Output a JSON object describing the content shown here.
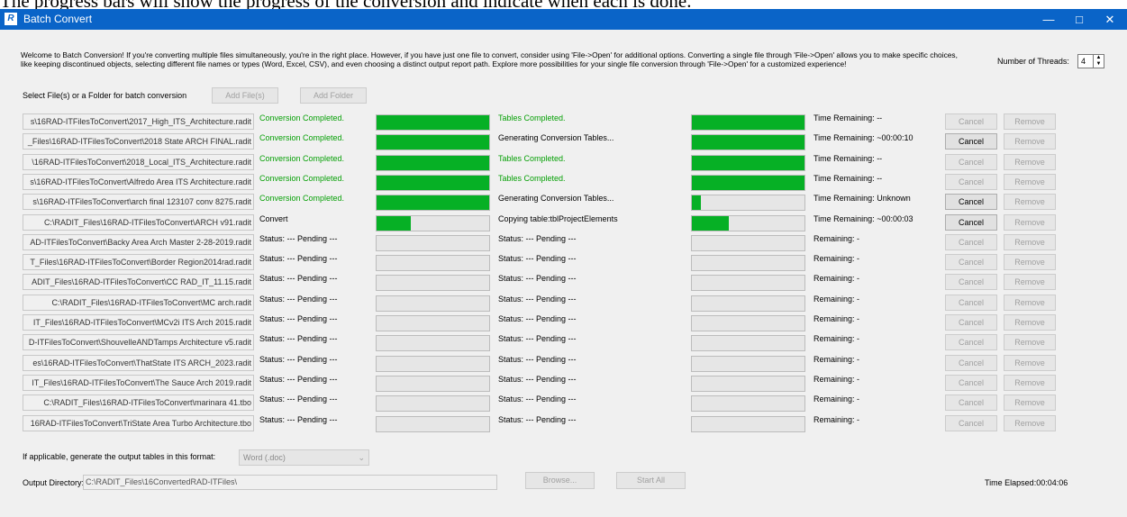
{
  "caption": "The progress bars will show the progress of the conversion and indicate when each is done.",
  "window": {
    "title": "Batch Convert",
    "icon_letter": "R"
  },
  "intro_text": "Welcome to Batch Conversion! If you're converting multiple files simultaneously, you're in the right place. However, if you have just one file to convert, consider using 'File->Open' for additional options. Converting a single file through 'File->Open' allows you to make specific choices, like keeping discontinued objects, selecting different file names or types (Word, Excel, CSV), and even choosing a distinct output report path. Explore more possibilities for your single file conversion through 'File->Open' for a customized experience!",
  "threads": {
    "label": "Number of Threads:",
    "value": "4"
  },
  "select_label": "Select File(s) or a Folder for batch conversion",
  "add_files_label": "Add File(s)",
  "add_folder_label": "Add Folder",
  "rows": [
    {
      "path": "s\\16RAD-ITFilesToConvert\\2017_High_ITS_Architecture.radit",
      "status1": "Conversion Completed.",
      "status1_done": true,
      "p1": 1.0,
      "status2": "Tables Completed.",
      "status2_done": true,
      "p2": 1.0,
      "time": "Time Remaining: --",
      "cancel_label": "Cancel",
      "cancel_enabled": false,
      "remove_label": "Remove"
    },
    {
      "path": "_Files\\16RAD-ITFilesToConvert\\2018 State ARCH FINAL.radit",
      "status1": "Conversion Completed.",
      "status1_done": true,
      "p1": 1.0,
      "status2": "Generating Conversion Tables...",
      "status2_done": false,
      "p2": 1.0,
      "time": "Time Remaining: ~00:00:10",
      "cancel_label": "Cancel",
      "cancel_enabled": true,
      "remove_label": "Remove"
    },
    {
      "path": "\\16RAD-ITFilesToConvert\\2018_Local_ITS_Architecture.radit",
      "status1": "Conversion Completed.",
      "status1_done": true,
      "p1": 1.0,
      "status2": "Tables Completed.",
      "status2_done": true,
      "p2": 1.0,
      "time": "Time Remaining: --",
      "cancel_label": "Cancel",
      "cancel_enabled": false,
      "remove_label": "Remove"
    },
    {
      "path": "s\\16RAD-ITFilesToConvert\\Alfredo Area ITS Architecture.radit",
      "status1": "Conversion Completed.",
      "status1_done": true,
      "p1": 1.0,
      "status2": "Tables Completed.",
      "status2_done": true,
      "p2": 1.0,
      "time": "Time Remaining: --",
      "cancel_label": "Cancel",
      "cancel_enabled": false,
      "remove_label": "Remove"
    },
    {
      "path": "s\\16RAD-ITFilesToConvert\\arch final 123107 conv 8275.radit",
      "status1": "Conversion Completed.",
      "status1_done": true,
      "p1": 1.0,
      "status2": "Generating Conversion Tables...",
      "status2_done": false,
      "p2": 0.08,
      "time": "Time Remaining: Unknown",
      "cancel_label": "Cancel",
      "cancel_enabled": true,
      "remove_label": "Remove"
    },
    {
      "path": "C:\\RADIT_Files\\16RAD-ITFilesToConvert\\ARCH v91.radit",
      "status1": "Convert",
      "status1_done": false,
      "p1": 0.3,
      "status2": "Copying table:tblProjectElements",
      "status2_done": false,
      "p2": 0.33,
      "time": "Time Remaining: ~00:00:03",
      "cancel_label": "Cancel",
      "cancel_enabled": true,
      "remove_label": "Remove"
    },
    {
      "path": "AD-ITFilesToConvert\\Backy Area Arch Master 2-28-2019.radit",
      "status1": "Status: --- Pending ---",
      "status1_done": false,
      "p1": 0,
      "status2": "Status: --- Pending ---",
      "status2_done": false,
      "p2": 0,
      "time": "Remaining: -",
      "cancel_label": "Cancel",
      "cancel_enabled": false,
      "remove_label": "Remove"
    },
    {
      "path": "T_Files\\16RAD-ITFilesToConvert\\Border Region2014rad.radit",
      "status1": "Status: --- Pending ---",
      "status1_done": false,
      "p1": 0,
      "status2": "Status: --- Pending ---",
      "status2_done": false,
      "p2": 0,
      "time": "Remaining: -",
      "cancel_label": "Cancel",
      "cancel_enabled": false,
      "remove_label": "Remove"
    },
    {
      "path": "ADIT_Files\\16RAD-ITFilesToConvert\\CC RAD_IT_11.15.radit",
      "status1": "Status: --- Pending ---",
      "status1_done": false,
      "p1": 0,
      "status2": "Status: --- Pending ---",
      "status2_done": false,
      "p2": 0,
      "time": "Remaining: -",
      "cancel_label": "Cancel",
      "cancel_enabled": false,
      "remove_label": "Remove"
    },
    {
      "path": "C:\\RADIT_Files\\16RAD-ITFilesToConvert\\MC arch.radit",
      "status1": "Status: --- Pending ---",
      "status1_done": false,
      "p1": 0,
      "status2": "Status: --- Pending ---",
      "status2_done": false,
      "p2": 0,
      "time": "Remaining: -",
      "cancel_label": "Cancel",
      "cancel_enabled": false,
      "remove_label": "Remove"
    },
    {
      "path": "IT_Files\\16RAD-ITFilesToConvert\\MCv2i ITS Arch 2015.radit",
      "status1": "Status: --- Pending ---",
      "status1_done": false,
      "p1": 0,
      "status2": "Status: --- Pending ---",
      "status2_done": false,
      "p2": 0,
      "time": "Remaining: -",
      "cancel_label": "Cancel",
      "cancel_enabled": false,
      "remove_label": "Remove"
    },
    {
      "path": "D-ITFilesToConvert\\ShouvelleANDTamps Architecture v5.radit",
      "status1": "Status: --- Pending ---",
      "status1_done": false,
      "p1": 0,
      "status2": "Status: --- Pending ---",
      "status2_done": false,
      "p2": 0,
      "time": "Remaining: -",
      "cancel_label": "Cancel",
      "cancel_enabled": false,
      "remove_label": "Remove"
    },
    {
      "path": "es\\16RAD-ITFilesToConvert\\ThatState ITS ARCH_2023.radit",
      "status1": "Status: --- Pending ---",
      "status1_done": false,
      "p1": 0,
      "status2": "Status: --- Pending ---",
      "status2_done": false,
      "p2": 0,
      "time": "Remaining: -",
      "cancel_label": "Cancel",
      "cancel_enabled": false,
      "remove_label": "Remove"
    },
    {
      "path": "IT_Files\\16RAD-ITFilesToConvert\\The Sauce Arch 2019.radit",
      "status1": "Status: --- Pending ---",
      "status1_done": false,
      "p1": 0,
      "status2": "Status: --- Pending ---",
      "status2_done": false,
      "p2": 0,
      "time": "Remaining: -",
      "cancel_label": "Cancel",
      "cancel_enabled": false,
      "remove_label": "Remove"
    },
    {
      "path": "C:\\RADIT_Files\\16RAD-ITFilesToConvert\\marinara 41.tbo",
      "status1": "Status: --- Pending ---",
      "status1_done": false,
      "p1": 0,
      "status2": "Status: --- Pending ---",
      "status2_done": false,
      "p2": 0,
      "time": "Remaining: -",
      "cancel_label": "Cancel",
      "cancel_enabled": false,
      "remove_label": "Remove"
    },
    {
      "path": "16RAD-ITFilesToConvert\\TriState Area Turbo Architecture.tbo",
      "status1": "Status: --- Pending ---",
      "status1_done": false,
      "p1": 0,
      "status2": "Status: --- Pending ---",
      "status2_done": false,
      "p2": 0,
      "time": "Remaining: -",
      "cancel_label": "Cancel",
      "cancel_enabled": false,
      "remove_label": "Remove"
    }
  ],
  "format": {
    "label": "If applicable, generate the output tables in this format:",
    "value": "Word (.doc)"
  },
  "output": {
    "label": "Output Directory:",
    "value": "C:\\RADIT_Files\\16ConvertedRAD-ITFiles\\"
  },
  "browse_label": "Browse...",
  "start_all_label": "Start All",
  "time_elapsed": "Time Elapsed:00:04:06",
  "colors": {
    "titlebar": "#0a64c8",
    "progress": "#06b025",
    "completed_text": "#07a007",
    "background": "#f0f0f0"
  },
  "icons": {
    "minimize": "minimize-icon",
    "maximize": "maximize-icon",
    "close": "close-icon",
    "spin": "spinner-icon",
    "dropdown": "chevron-down-icon"
  }
}
